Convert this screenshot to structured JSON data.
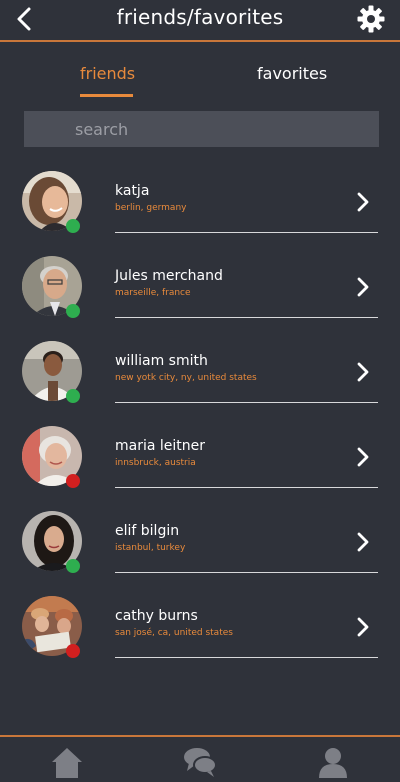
{
  "header": {
    "title": "friends/favorites",
    "back_icon": "chevron-left-icon",
    "settings_icon": "gear-icon"
  },
  "tabs": [
    {
      "label": "friends",
      "active": true
    },
    {
      "label": "favorites",
      "active": false
    }
  ],
  "search": {
    "placeholder": "search",
    "value": ""
  },
  "friends": [
    {
      "name": "katja",
      "location": "berlin, germany",
      "status": "online"
    },
    {
      "name": "Jules merchand",
      "location": "marseille, france",
      "status": "online"
    },
    {
      "name": "william smith",
      "location": "new yotk city, ny, united states",
      "status": "online"
    },
    {
      "name": "maria leitner",
      "location": "innsbruck, austria",
      "status": "offline"
    },
    {
      "name": "elif bilgin",
      "location": "istanbul, turkey",
      "status": "online"
    },
    {
      "name": "cathy burns",
      "location": "san josé, ca, united states",
      "status": "offline"
    }
  ],
  "bottom_nav": [
    {
      "icon": "home-icon"
    },
    {
      "icon": "chat-icon"
    },
    {
      "icon": "profile-icon"
    }
  ],
  "colors": {
    "background": "#2f323a",
    "accent": "#e88a3c",
    "online": "#2eae4f",
    "offline": "#d21f1f",
    "search_bg": "#4c4f58"
  }
}
